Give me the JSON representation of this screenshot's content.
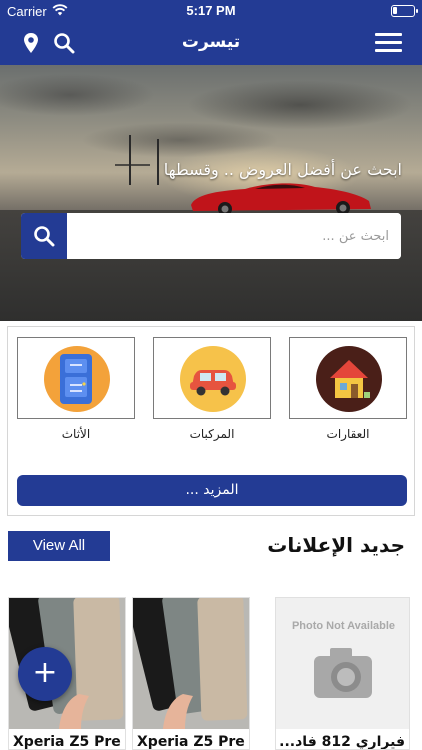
{
  "status": {
    "carrier": "Carrier",
    "time": "5:17 PM"
  },
  "nav": {
    "title": "تيسرت"
  },
  "hero": {
    "tagline": "ابحث عن أفضل العروض .. وقسطها",
    "search_placeholder": "ابحث عن ..."
  },
  "categories": [
    {
      "label": "العقارات",
      "icon": "house-icon",
      "color": "#4a1f18"
    },
    {
      "label": "المركبات",
      "icon": "car-icon",
      "color": "#f6c24a"
    },
    {
      "label": "الأثاث",
      "icon": "furniture-icon",
      "color": "#f3a23a"
    }
  ],
  "more_label": "المزيد ...",
  "view_all_label": "View All",
  "new_ads_title": "جديد الإعلانات",
  "listings": [
    {
      "title": "Xperia Z5 Pre..."
    },
    {
      "title": "Xperia Z5 Pre..."
    },
    {
      "title": "فيراري 812 فاد...",
      "image_text": "Photo Not Available"
    }
  ],
  "fab_label": "+",
  "colors": {
    "primary": "#233b94",
    "background": "#ffffff"
  }
}
